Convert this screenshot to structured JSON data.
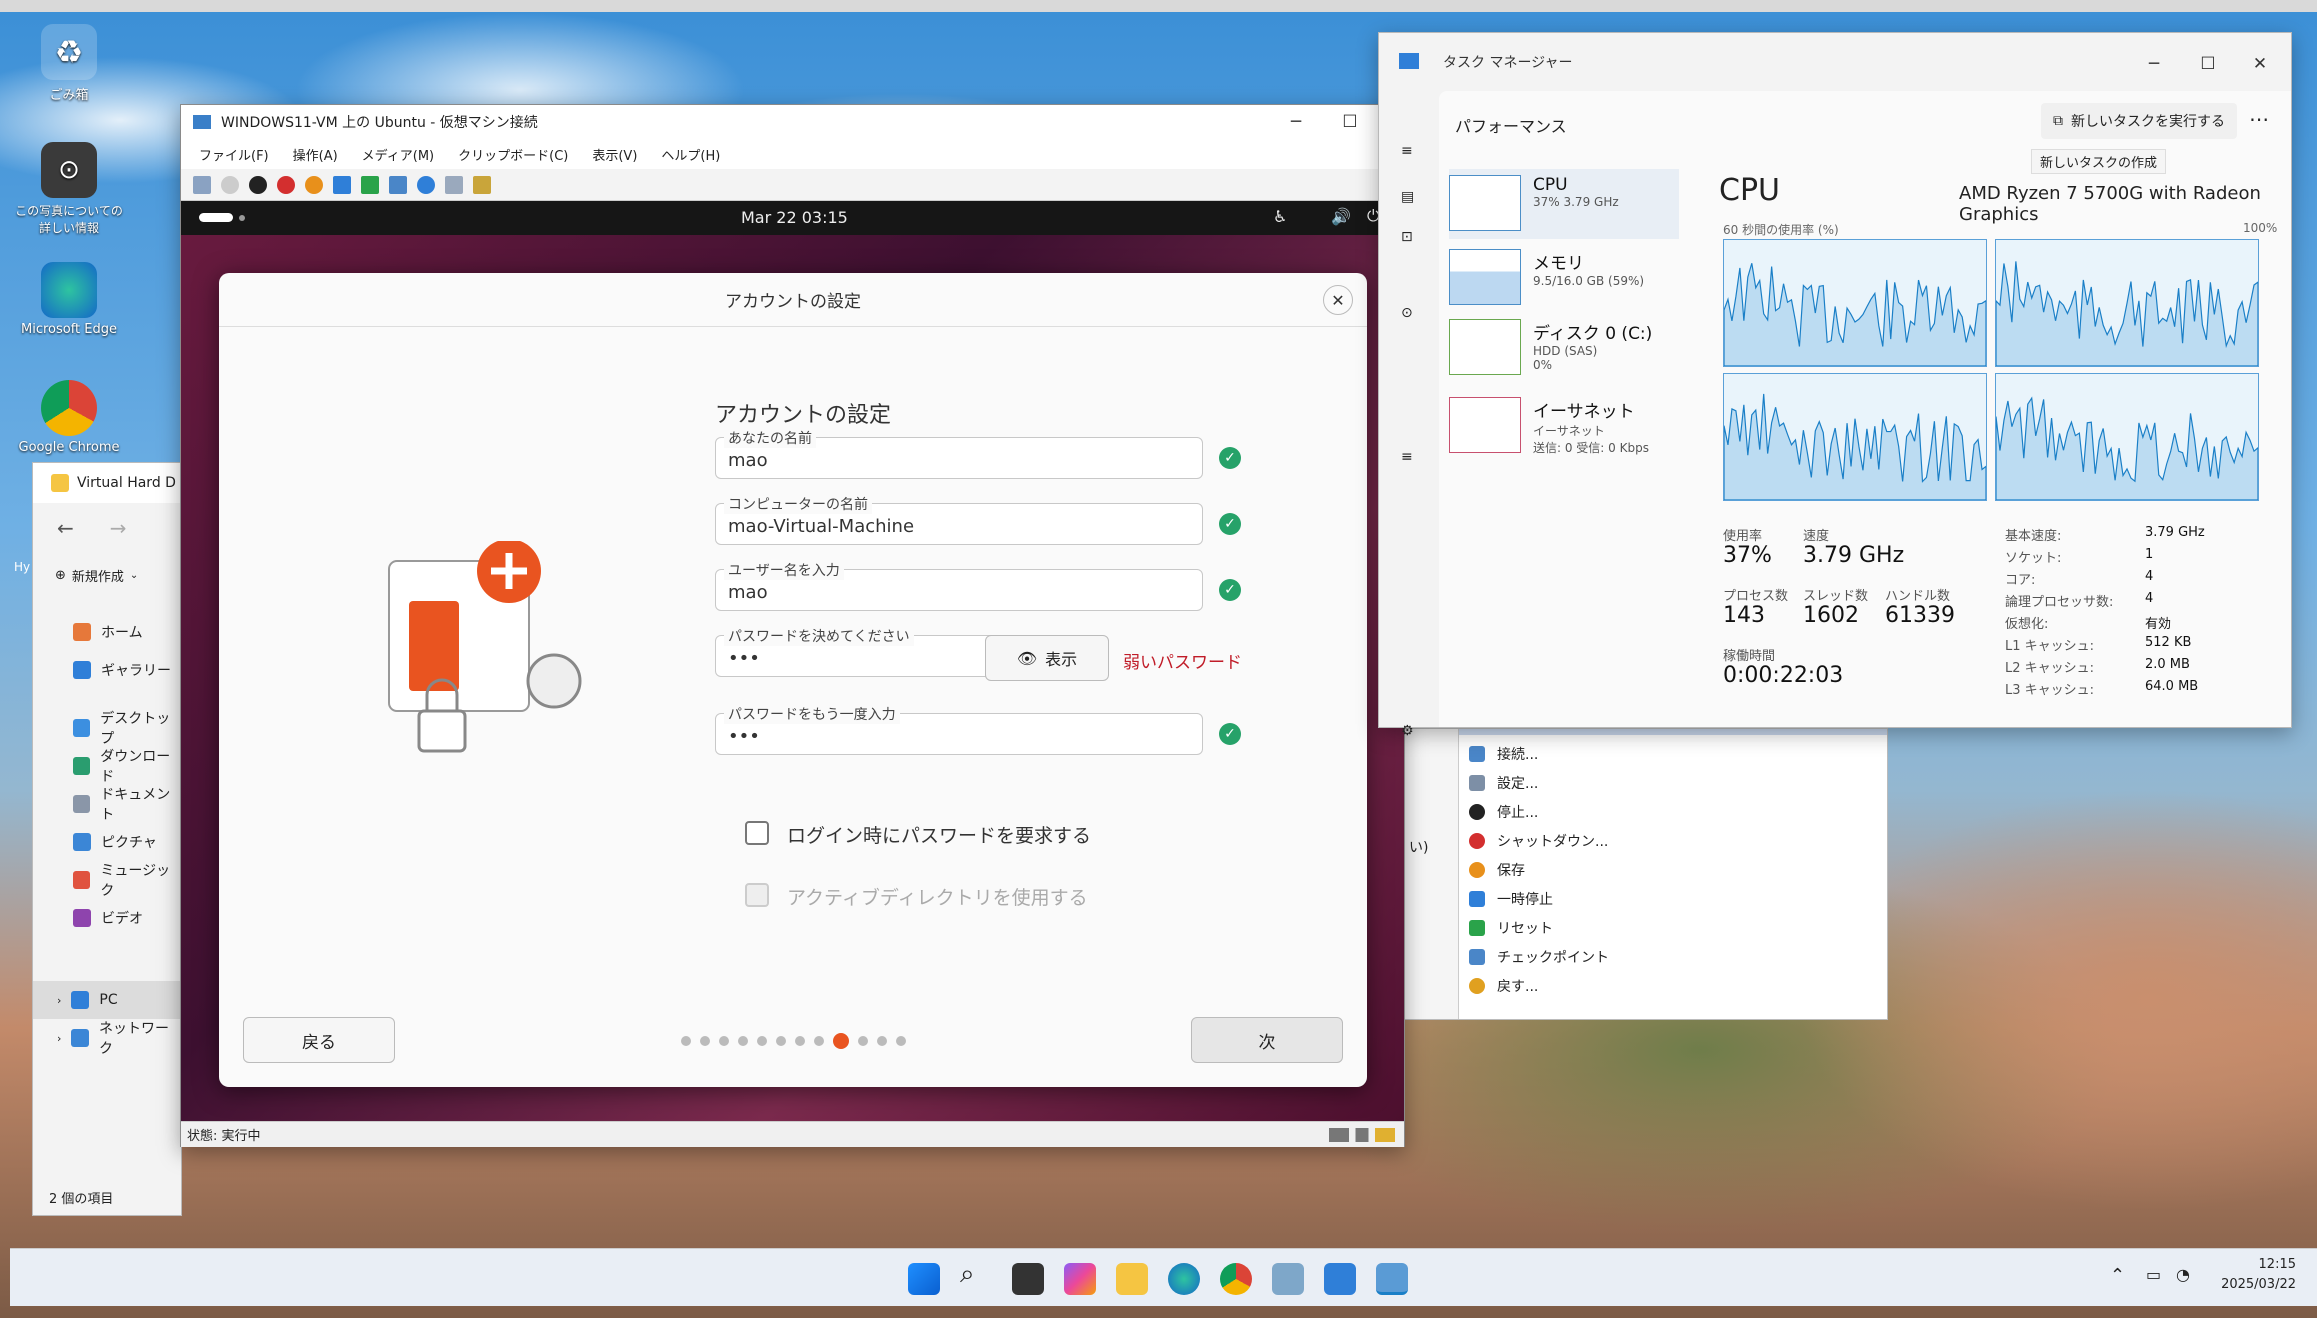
{
  "desktop": {
    "icons": [
      {
        "label": "ごみ箱",
        "icon": "recycle-bin-icon"
      },
      {
        "label": "この写真についての詳しい情報",
        "icon": "info-camera-icon"
      },
      {
        "label": "Microsoft Edge",
        "icon": "edge-icon"
      },
      {
        "label": "Google Chrome",
        "icon": "chrome-icon"
      }
    ]
  },
  "explorer": {
    "title": "Virtual Hard D",
    "new_label": "新規作成",
    "nav": [
      "ホーム",
      "ギャラリー",
      "デスクトップ",
      "ダウンロード",
      "ドキュメント",
      "ピクチャ",
      "ミュージック",
      "ビデオ",
      "PC",
      "ネットワーク"
    ],
    "status": "2 個の項目",
    "partial_label": "Hy"
  },
  "vm": {
    "title": "WINDOWS11-VM 上の Ubuntu - 仮想マシン接続",
    "menu": [
      "ファイル(F)",
      "操作(A)",
      "メディア(M)",
      "クリップボード(C)",
      "表示(V)",
      "ヘルプ(H)"
    ],
    "status": "状態: 実行中",
    "ubuntu": {
      "clock": "Mar 22  03:15",
      "dialog_title": "アカウントの設定",
      "heading": "アカウントの設定",
      "fields": {
        "name": {
          "label": "あなたの名前",
          "value": "mao"
        },
        "computer": {
          "label": "コンピューターの名前",
          "value": "mao-Virtual-Machine"
        },
        "username": {
          "label": "ユーザー名を入力",
          "value": "mao"
        },
        "password": {
          "label": "パスワードを決めてください",
          "value": "•••",
          "show": "表示",
          "strength": "弱いパスワード"
        },
        "confirm": {
          "label": "パスワードをもう一度入力",
          "value": "•••"
        }
      },
      "require_login": "ログイン時にパスワードを要求する",
      "active_directory": "アクティブディレクトリを使用する",
      "back": "戻る",
      "next": "次",
      "step_current": 9,
      "step_total": 12
    }
  },
  "actions": [
    "接続...",
    "設定...",
    "停止...",
    "シャットダウン...",
    "保存",
    "一時停止",
    "リセット",
    "チェックポイント",
    "戻す..."
  ],
  "actions_partial": "い)",
  "taskmgr": {
    "title": "タスク マネージャー",
    "section": "パフォーマンス",
    "new_task": "新しいタスクを実行する",
    "tooltip": "新しいタスクの作成",
    "sidebar": [
      {
        "name": "CPU",
        "sub": "37%  3.79 GHz"
      },
      {
        "name": "メモリ",
        "sub": "9.5/16.0 GB (59%)"
      },
      {
        "name": "ディスク 0 (C:)",
        "sub": "HDD (SAS)",
        "sub2": "0%"
      },
      {
        "name": "イーサネット",
        "sub": "イーサネット",
        "sub2": "送信: 0 受信: 0 Kbps"
      }
    ],
    "cpu_title": "CPU",
    "cpu_model": "AMD Ryzen 7 5700G with Radeon Graphics",
    "graph_caption": "60 秒間の使用率 (%)",
    "graph_max": "100%",
    "stats": {
      "usage_label": "使用率",
      "usage": "37%",
      "speed_label": "速度",
      "speed": "3.79 GHz",
      "proc_label": "プロセス数",
      "proc": "143",
      "thread_label": "スレッド数",
      "thread": "1602",
      "handle_label": "ハンドル数",
      "handle": "61339",
      "uptime_label": "稼働時間",
      "uptime": "0:00:22:03"
    },
    "specs": [
      {
        "k": "基本速度:",
        "v": "3.79 GHz"
      },
      {
        "k": "ソケット:",
        "v": "1"
      },
      {
        "k": "コア:",
        "v": "4"
      },
      {
        "k": "論理プロセッサ数:",
        "v": "4"
      },
      {
        "k": "仮想化:",
        "v": "有効"
      },
      {
        "k": "L1 キャッシュ:",
        "v": "512 KB"
      },
      {
        "k": "L2 キャッシュ:",
        "v": "2.0 MB"
      },
      {
        "k": "L3 キャッシュ:",
        "v": "64.0 MB"
      }
    ]
  },
  "taskbar": {
    "time": "12:15",
    "date": "2025/03/22"
  },
  "colors": {
    "accent": "#e95420",
    "ok": "#26a269",
    "weak": "#c01c28",
    "cpu_line": "#1a7fc7"
  }
}
